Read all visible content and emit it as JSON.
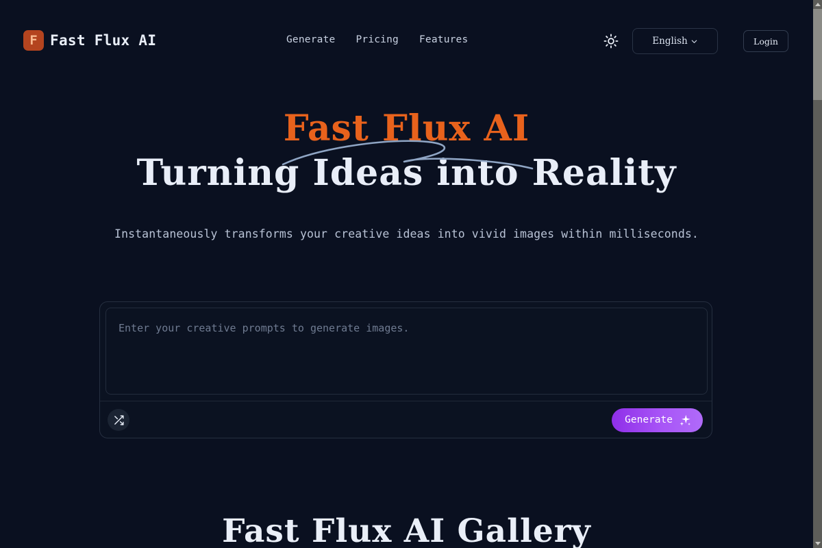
{
  "page": {
    "background_color": "#0a1020",
    "accent_orange": "#e8621c",
    "accent_purple": "#a855f7",
    "swoosh_color": "#8fa5c4"
  },
  "header": {
    "brand": {
      "mark_letter": "F",
      "mark_color": "#b4441f",
      "name": "Fast Flux AI"
    },
    "nav": [
      {
        "label": "Generate"
      },
      {
        "label": "Pricing"
      },
      {
        "label": "Features"
      }
    ],
    "theme_toggle": {
      "icon": "sun-icon"
    },
    "language": {
      "value": "English",
      "chevron": "chevron-down-icon"
    },
    "login": {
      "label": "Login"
    }
  },
  "hero": {
    "title_line1": "Fast Flux AI",
    "title_line2": "Turning Ideas into Reality",
    "subtitle": "Instantaneously transforms your creative ideas into vivid images within milliseconds."
  },
  "prompt": {
    "placeholder": "Enter your creative prompts to generate images.",
    "value": "",
    "shuffle": {
      "icon": "shuffle-icon"
    },
    "generate": {
      "label": "Generate",
      "icon": "sparkles-icon"
    }
  },
  "gallery": {
    "heading": "Fast Flux AI Gallery"
  },
  "scrollbar": {
    "up_arrow": "scroll-up-arrow-icon",
    "down_arrow": "scroll-down-arrow-icon"
  }
}
